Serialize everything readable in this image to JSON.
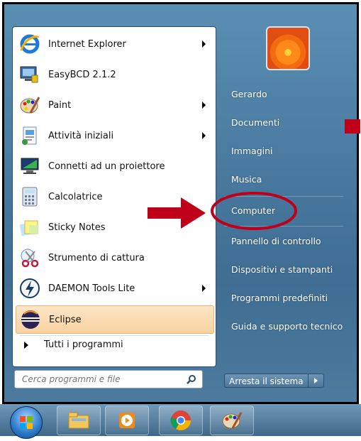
{
  "programs": [
    {
      "label": "Internet Explorer",
      "icon": "internet-explorer-icon",
      "has_submenu": true
    },
    {
      "label": "EasyBCD 2.1.2",
      "icon": "easybcd-icon",
      "has_submenu": false
    },
    {
      "label": "Paint",
      "icon": "paint-palette-icon",
      "has_submenu": true
    },
    {
      "label": "Attività iniziali",
      "icon": "getting-started-icon",
      "has_submenu": true
    },
    {
      "label": "Connetti ad un proiettore",
      "icon": "projector-icon",
      "has_submenu": false
    },
    {
      "label": "Calcolatrice",
      "icon": "calculator-icon",
      "has_submenu": false
    },
    {
      "label": "Sticky Notes",
      "icon": "sticky-notes-icon",
      "has_submenu": false
    },
    {
      "label": "Strumento di cattura",
      "icon": "snipping-tool-icon",
      "has_submenu": false
    },
    {
      "label": "DAEMON Tools Lite",
      "icon": "daemon-tools-icon",
      "has_submenu": true
    },
    {
      "label": "Eclipse",
      "icon": "eclipse-icon",
      "has_submenu": false,
      "highlighted": true
    }
  ],
  "all_programs": "Tutti i programmi",
  "search": {
    "placeholder": "Cerca programmi e file"
  },
  "right_links": [
    {
      "label": "Gerardo"
    },
    {
      "label": "Documenti"
    },
    {
      "label": "Immagini"
    },
    {
      "label": "Musica"
    },
    {
      "label": "Computer",
      "circled": true
    },
    {
      "label": "Pannello di controllo"
    },
    {
      "label": "Dispositivi e stampanti"
    },
    {
      "label": "Programmi predefiniti"
    },
    {
      "label": "Guida e supporto tecnico"
    }
  ],
  "shutdown_label": "Arresta il sistema",
  "taskbar": [
    "windows-explorer-icon",
    "media-player-icon",
    "chrome-icon",
    "paint-icon"
  ],
  "colors": {
    "annotation_red": "#c0001a",
    "highlight": "#f9d2a0"
  }
}
